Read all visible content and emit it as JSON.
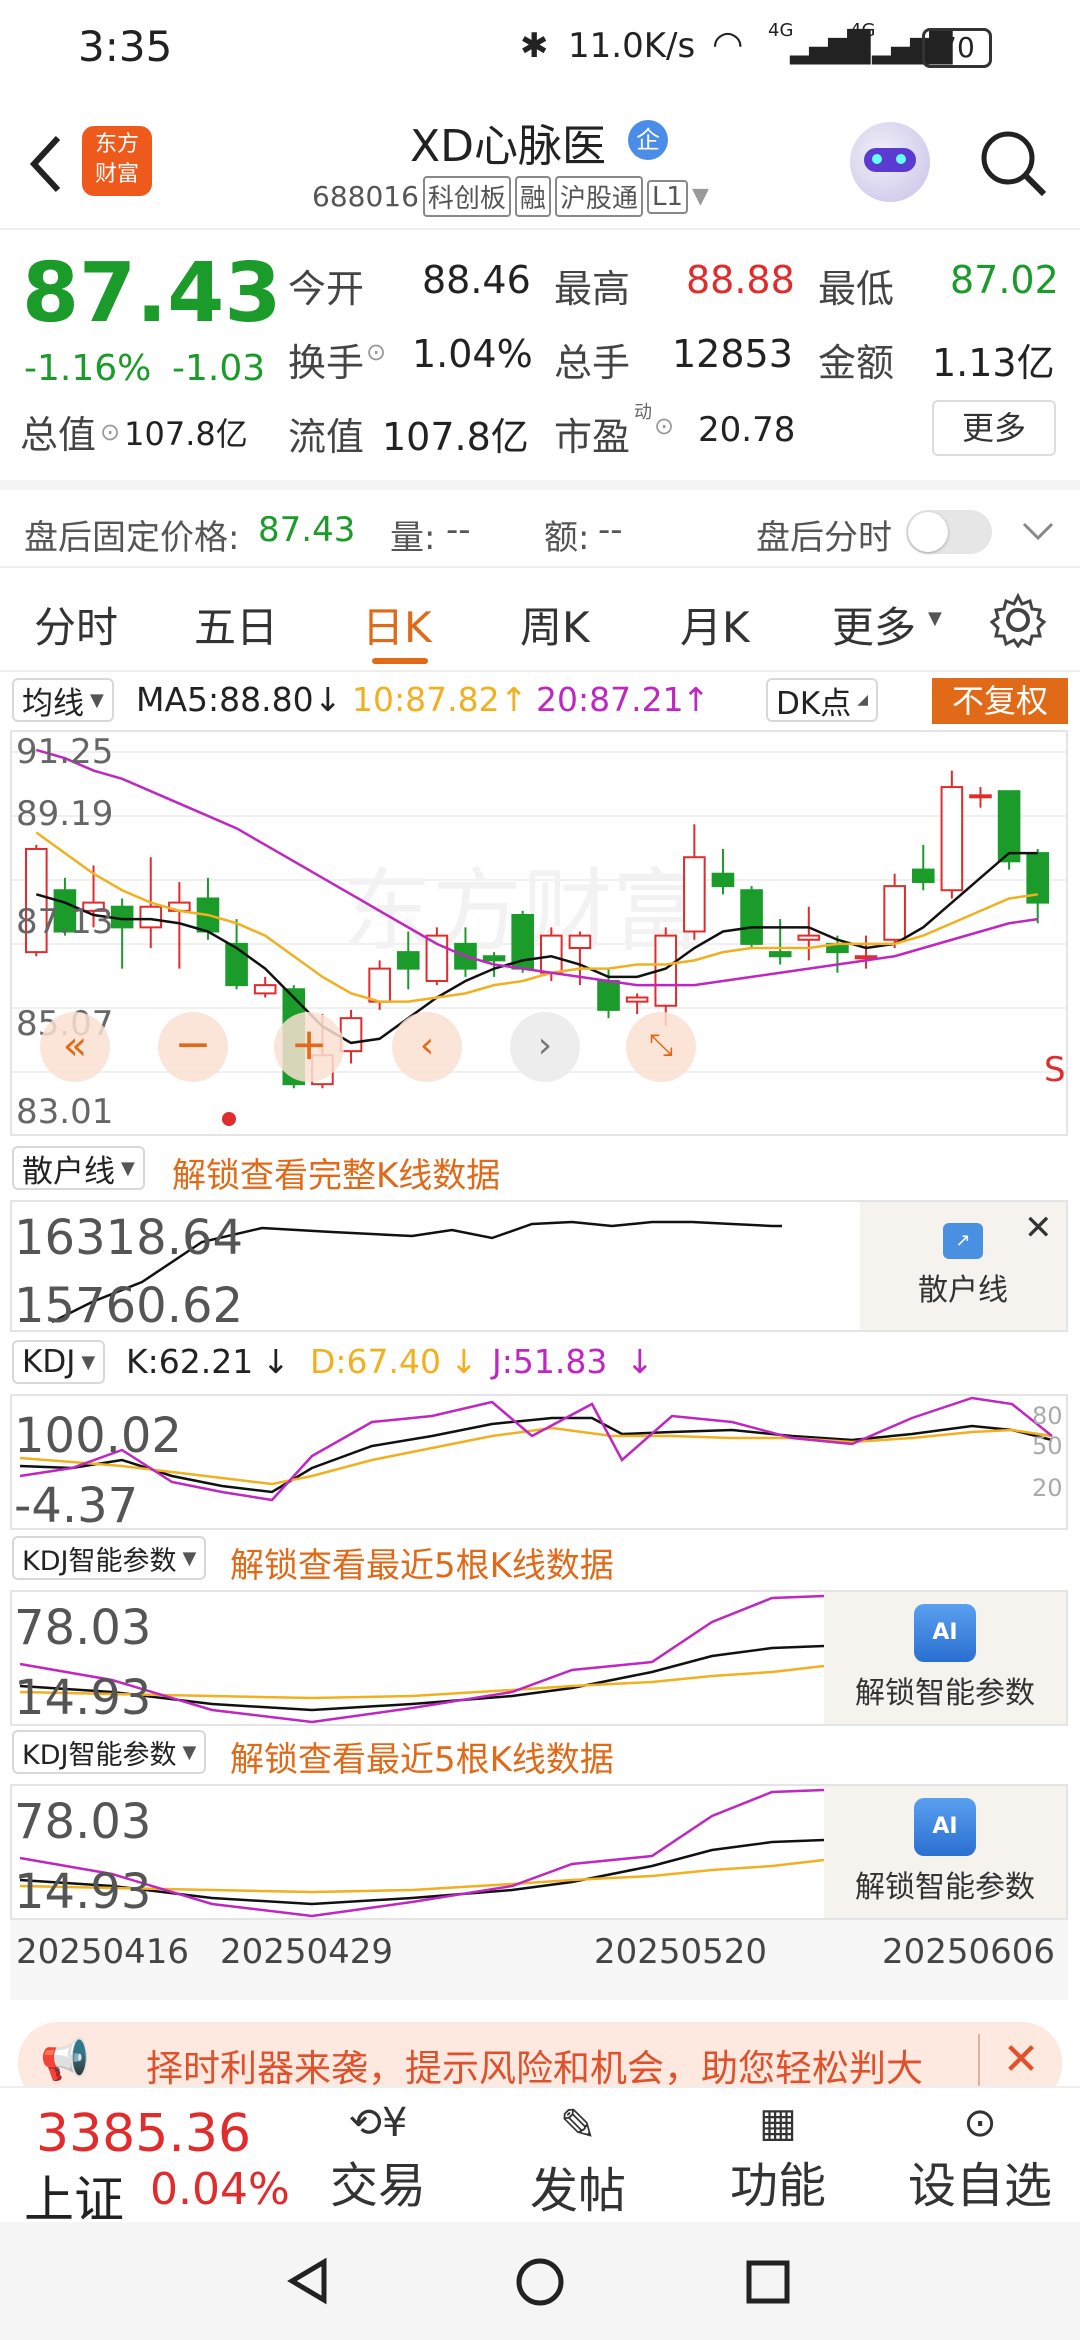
{
  "status_bar": {
    "time": "3:35",
    "net_speed": "11.0K/s",
    "battery": "70",
    "net1": "4G",
    "net2": "4G"
  },
  "header": {
    "back_icon": "chevron-left-icon",
    "brand_logo": "东方\n财富",
    "stock_name": "XD心脉医",
    "badge": "企",
    "code": "688016",
    "tags": [
      "科创板",
      "融",
      "沪股通",
      "L1"
    ],
    "search_icon": "search-icon"
  },
  "quote": {
    "price": "87.43",
    "change_pct": "-1.16%",
    "change_abs": "-1.03",
    "open_label": "今开",
    "open": "88.46",
    "high_label": "最高",
    "high": "88.88",
    "low_label": "最低",
    "low": "87.02",
    "turnover_label": "换手",
    "turnover": "1.04%",
    "volume_label": "总手",
    "volume": "12853",
    "amount_label": "金额",
    "amount": "1.13亿",
    "mktcap_label": "总值",
    "mktcap": "107.8亿",
    "float_label": "流值",
    "float": "107.8亿",
    "pe_label": "市盈",
    "pe_sup": "动",
    "pe": "20.78",
    "more_label": "更多"
  },
  "after_hours": {
    "price_label": "盘后固定价格:",
    "price": "87.43",
    "vol_label": "量:",
    "vol": "--",
    "amt_label": "额:",
    "amt": "--",
    "toggle_label": "盘后分时"
  },
  "tabs": [
    "分时",
    "五日",
    "日K",
    "周K",
    "月K",
    "更多"
  ],
  "ma_bar": {
    "dropdown": "均线",
    "ma5": "MA5:88.80",
    "ma10": "10:87.82",
    "ma20": "20:87.21",
    "dk_label": "DK点",
    "adjust_label": "不复权"
  },
  "kline": {
    "y_labels": [
      "91.25",
      "89.19",
      "87.13",
      "85.07",
      "83.01"
    ],
    "watermark": "东方财富",
    "s_marker": "S"
  },
  "retail": {
    "dropdown": "散户线",
    "unlock": "解锁查看完整K线数据",
    "y_top": "16318.64",
    "y_bot": "15760.62",
    "card_label": "散户线"
  },
  "kdj": {
    "dropdown": "KDJ",
    "k": "K:62.21",
    "d": "D:67.40",
    "j": "J:51.83",
    "y_top": "100.02",
    "y_bot": "-4.37",
    "levels": [
      "80",
      "50",
      "20"
    ]
  },
  "kdj_smart1": {
    "dropdown": "KDJ智能参数",
    "unlock": "解锁查看最近5根K线数据",
    "y_top": "78.03",
    "y_bot": "14.93",
    "card_label": "解锁智能参数",
    "card_icon": "AI"
  },
  "kdj_smart2": {
    "dropdown": "KDJ智能参数",
    "unlock": "解锁查看最近5根K线数据",
    "y_top": "78.03",
    "y_bot": "14.93",
    "card_label": "解锁智能参数",
    "card_icon": "AI"
  },
  "dates": [
    "20250416",
    "20250429",
    "20250520",
    "20250606"
  ],
  "banner": {
    "text": "择时利器来袭，提示风险和机会，助您轻松判大"
  },
  "bottom_bar": {
    "index_value": "3385.36",
    "index_name": "上证",
    "index_change": "0.04%",
    "items": [
      "交易",
      "发帖",
      "功能",
      "设自选"
    ]
  },
  "colors": {
    "up": "#e02c2c",
    "down": "#1a9b2a",
    "ma10": "#f0b020",
    "ma20": "#c026c0",
    "accent": "#e06a18"
  }
}
